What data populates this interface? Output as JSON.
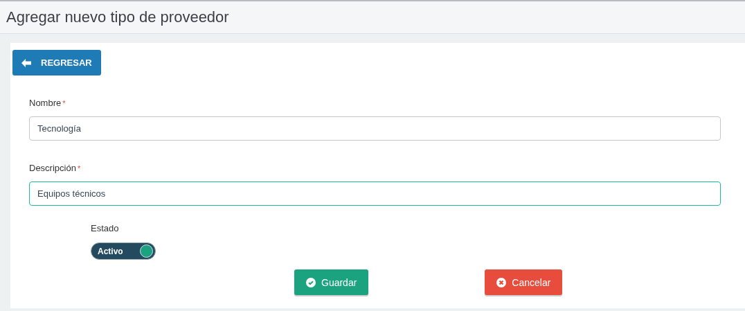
{
  "header": {
    "title": "Agregar nuevo tipo de proveedor"
  },
  "back_button": {
    "label": "REGRESAR"
  },
  "fields": [
    {
      "label": "Nombre",
      "marker": "*",
      "value": "Tecnología",
      "focused": false
    },
    {
      "label": "Descripción",
      "marker": "*",
      "value": "Equipos técnicos",
      "focused": true
    }
  ],
  "status": {
    "label": "Estado",
    "toggle_label": "Activo",
    "on": true
  },
  "actions": [
    {
      "kind": "save",
      "label": "Guardar"
    },
    {
      "kind": "cancel",
      "label": "Cancelar"
    }
  ]
}
